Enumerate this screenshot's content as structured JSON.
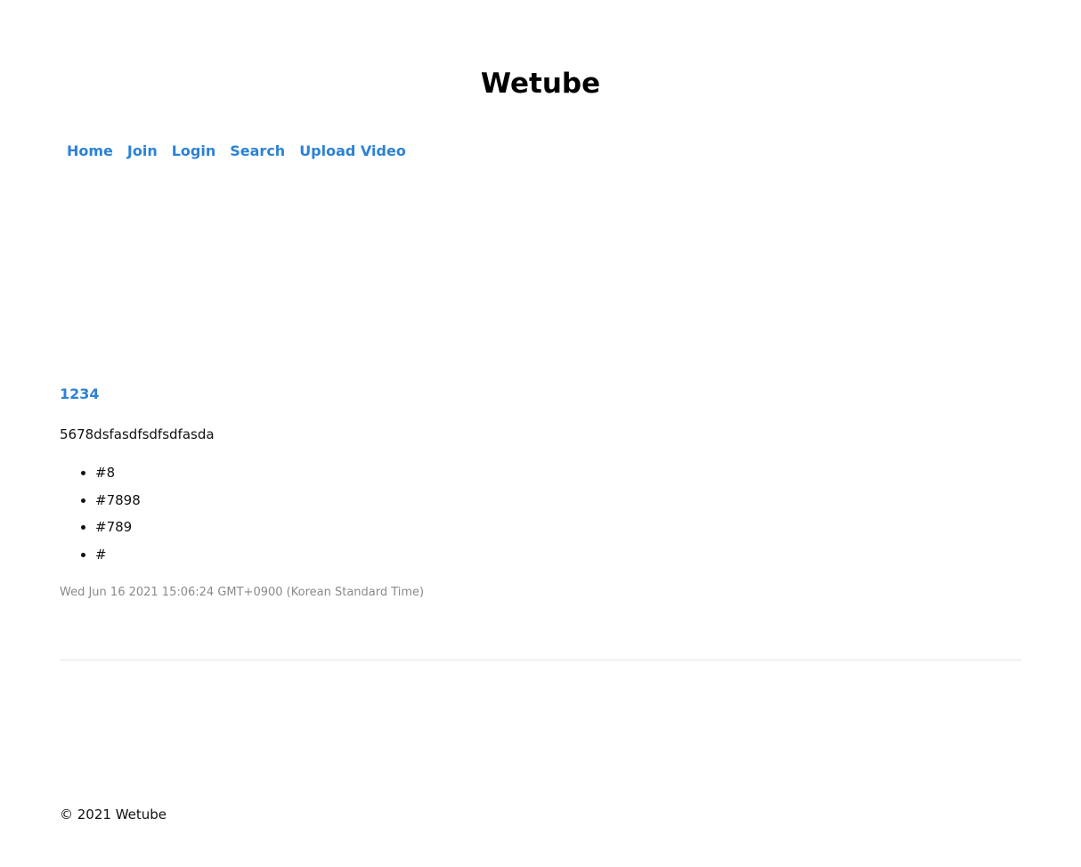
{
  "header": {
    "title": "Wetube"
  },
  "nav": {
    "items": [
      {
        "label": "Home"
      },
      {
        "label": "Join"
      },
      {
        "label": "Login"
      },
      {
        "label": "Search"
      },
      {
        "label": "Upload Video"
      }
    ]
  },
  "video": {
    "title": "1234",
    "description": "5678dsfasdfsdfsdfasda",
    "hashtags": [
      "#8",
      "#7898",
      "#789",
      "#"
    ],
    "created_at": "Wed Jun 16 2021 15:06:24 GMT+0900 (Korean Standard Time)"
  },
  "footer": {
    "text": "© 2021 Wetube"
  },
  "colors": {
    "link": "#2c82d4",
    "muted": "#8a8a8a",
    "divider": "#e6e6e6"
  }
}
